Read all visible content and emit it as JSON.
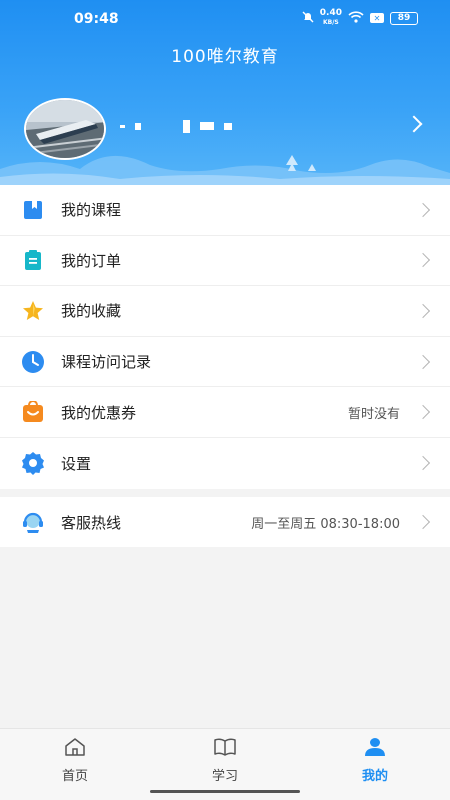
{
  "status_bar": {
    "time": "09:48",
    "net_speed": "0.40",
    "net_unit": "KB/S",
    "battery": "89",
    "icons": [
      "mute-icon",
      "speed-indicator",
      "wifi-icon",
      "close-box-icon",
      "battery-icon"
    ]
  },
  "header": {
    "title": "100唯尔教育"
  },
  "menu": {
    "items": [
      {
        "label": "我的课程",
        "value": "",
        "icon": "book-icon",
        "color": "#2d8cf0"
      },
      {
        "label": "我的订单",
        "value": "",
        "icon": "clipboard-icon",
        "color": "#17b7c9"
      },
      {
        "label": "我的收藏",
        "value": "",
        "icon": "star-icon",
        "color": "#f6b51e"
      },
      {
        "label": "课程访问记录",
        "value": "",
        "icon": "clock-icon",
        "color": "#2d8cf0"
      },
      {
        "label": "我的优惠券",
        "value": "暂时没有",
        "icon": "bag-icon",
        "color": "#f58a1f"
      },
      {
        "label": "设置",
        "value": "",
        "icon": "gear-icon",
        "color": "#2d8cf0"
      }
    ]
  },
  "service": {
    "label": "客服热线",
    "hours": "周一至周五 08:30-18:00",
    "icon": "headset-icon"
  },
  "bottom_nav": {
    "items": [
      {
        "label": "首页",
        "icon": "home-icon",
        "active": false
      },
      {
        "label": "学习",
        "icon": "open-book-icon",
        "active": false
      },
      {
        "label": "我的",
        "icon": "user-icon",
        "active": true
      }
    ]
  },
  "colors": {
    "primary": "#1f8ff2",
    "background": "#f3f3f3"
  }
}
